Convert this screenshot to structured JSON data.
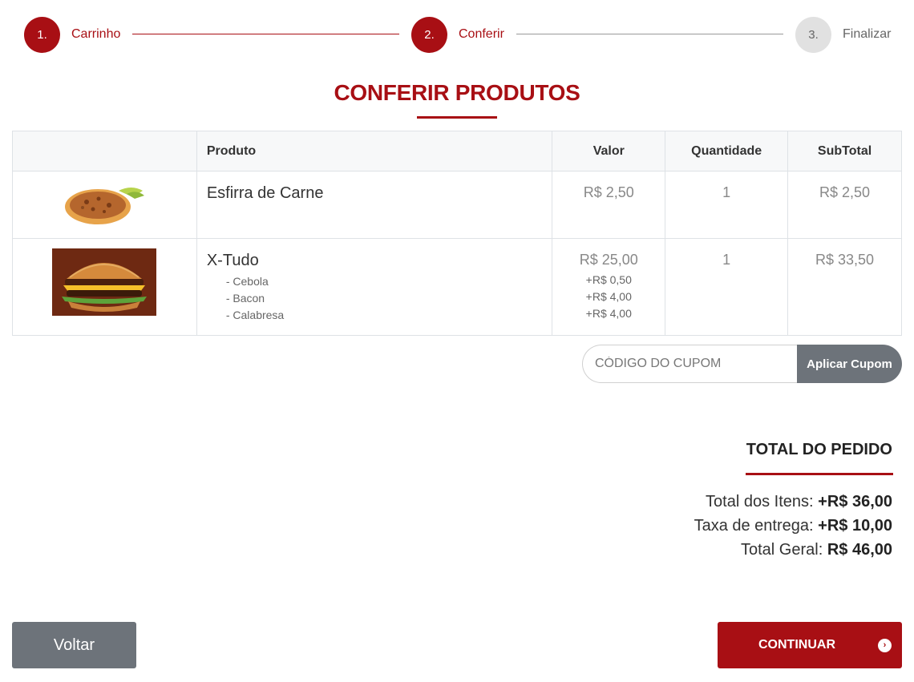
{
  "stepper": {
    "steps": [
      {
        "number": "1.",
        "label": "Carrinho",
        "state": "active"
      },
      {
        "number": "2.",
        "label": "Conferir",
        "state": "active"
      },
      {
        "number": "3.",
        "label": "Finalizar",
        "state": "inactive"
      }
    ]
  },
  "page_title": "CONFERIR PRODUTOS",
  "table": {
    "headers": [
      "",
      "Produto",
      "Valor",
      "Quantidade",
      "SubTotal"
    ],
    "rows": [
      {
        "image": "pizza-image",
        "name": "Esfirra de Carne",
        "extras": [],
        "price": "R$ 2,50",
        "extra_prices": [],
        "quantity": "1",
        "subtotal": "R$ 2,50"
      },
      {
        "image": "burger-image",
        "name": "X-Tudo",
        "extras": [
          "- Cebola",
          "- Bacon",
          "- Calabresa"
        ],
        "price": "R$ 25,00",
        "extra_prices": [
          "+R$ 0,50",
          "+R$ 4,00",
          "+R$ 4,00"
        ],
        "quantity": "1",
        "subtotal": "R$ 33,50"
      }
    ]
  },
  "coupon": {
    "placeholder": "CÓDIGO DO CUPOM",
    "button_label": "Aplicar Cupom"
  },
  "totals": {
    "title": "TOTAL DO PEDIDO",
    "items_label": "Total dos Itens:",
    "items_value": "+R$ 36,00",
    "delivery_label": "Taxa de entrega:",
    "delivery_value": "+R$ 10,00",
    "grand_label": "Total Geral:",
    "grand_value": "R$ 46,00"
  },
  "actions": {
    "back_label": "Voltar",
    "continue_label": "CONTINUAR",
    "continue_icon": "chevron-right-circle-icon"
  },
  "colors": {
    "accent": "#a80f14",
    "secondary_button": "#6d737a",
    "inactive_step": "#e1e1e1"
  }
}
